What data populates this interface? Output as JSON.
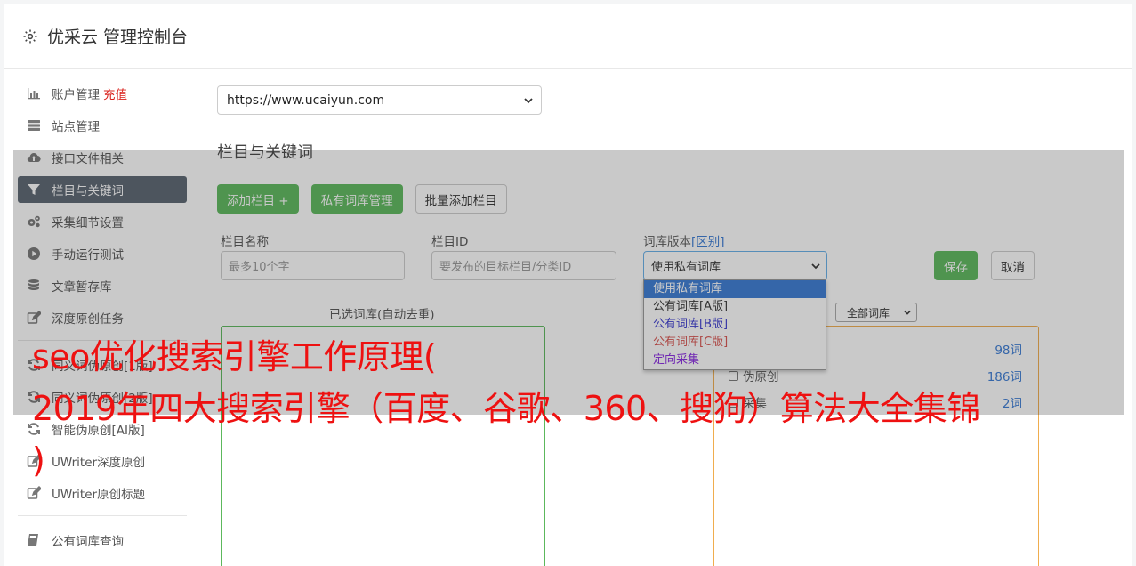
{
  "header": {
    "title": "优采云 管理控制台",
    "icon": "gear-icon"
  },
  "sidebar": {
    "items": [
      {
        "label": "账户管理",
        "badge": "充值",
        "icon": "bar-chart-icon"
      },
      {
        "label": "站点管理",
        "icon": "server-icon"
      },
      {
        "label": "接口文件相关",
        "icon": "cloud-upload-icon"
      },
      {
        "label": "栏目与关键词",
        "icon": "filter-icon",
        "active": true
      },
      {
        "label": "采集细节设置",
        "icon": "cogs-icon"
      },
      {
        "label": "手动运行测试",
        "icon": "play-circle-icon"
      },
      {
        "label": "文章暂存库",
        "icon": "database-icon"
      },
      {
        "label": "深度原创任务",
        "icon": "edit-icon"
      },
      {
        "label": "同义词伪原创[1版]",
        "icon": "refresh-icon"
      },
      {
        "label": "同义词伪原创[2版]",
        "icon": "refresh-icon"
      },
      {
        "label": "智能伪原创[AI版]",
        "icon": "refresh-icon"
      },
      {
        "label": "UWriter深度原创",
        "icon": "edit-icon"
      },
      {
        "label": "UWriter原创标题",
        "icon": "edit-icon"
      },
      {
        "label": "公有词库查询",
        "icon": "book-icon"
      }
    ]
  },
  "main": {
    "site_select": "https://www.ucaiyun.com",
    "section_title": "栏目与关键词",
    "buttons": {
      "add_column": "添加栏目 +",
      "private_lib": "私有词库管理",
      "batch_add": "批量添加栏目"
    },
    "form": {
      "name_label": "栏目名称",
      "name_placeholder": "最多10个字",
      "id_label": "栏目ID",
      "id_placeholder": "要发布的目标栏目/分类ID",
      "version_label": "词库版本",
      "version_link": "[区别]",
      "version_value": "使用私有词库",
      "save": "保存",
      "cancel": "取消"
    },
    "version_options": [
      {
        "label": "使用私有词库",
        "color": "#ffffff"
      },
      {
        "label": "公有词库[A版]",
        "color": "#333333"
      },
      {
        "label": "公有词库[B版]",
        "color": "#3a3ad0"
      },
      {
        "label": "公有词库[C版]",
        "color": "#d9534f"
      },
      {
        "label": "定向采集",
        "color": "#8a2be2"
      }
    ],
    "selected_libs_label": "已选词库(自动去重)",
    "lib_filter": "全部词库",
    "libs": [
      {
        "name": "",
        "count": "98词"
      },
      {
        "name": "伪原创",
        "count": "186词"
      },
      {
        "name": "采集",
        "count": "2词"
      }
    ]
  },
  "watermark": {
    "line1": "seo优化搜索引擎工作原理(",
    "line2": "2019年四大搜索引擎（百度、谷歌、360、搜狗）算法大全集锦",
    "line3": ")"
  }
}
